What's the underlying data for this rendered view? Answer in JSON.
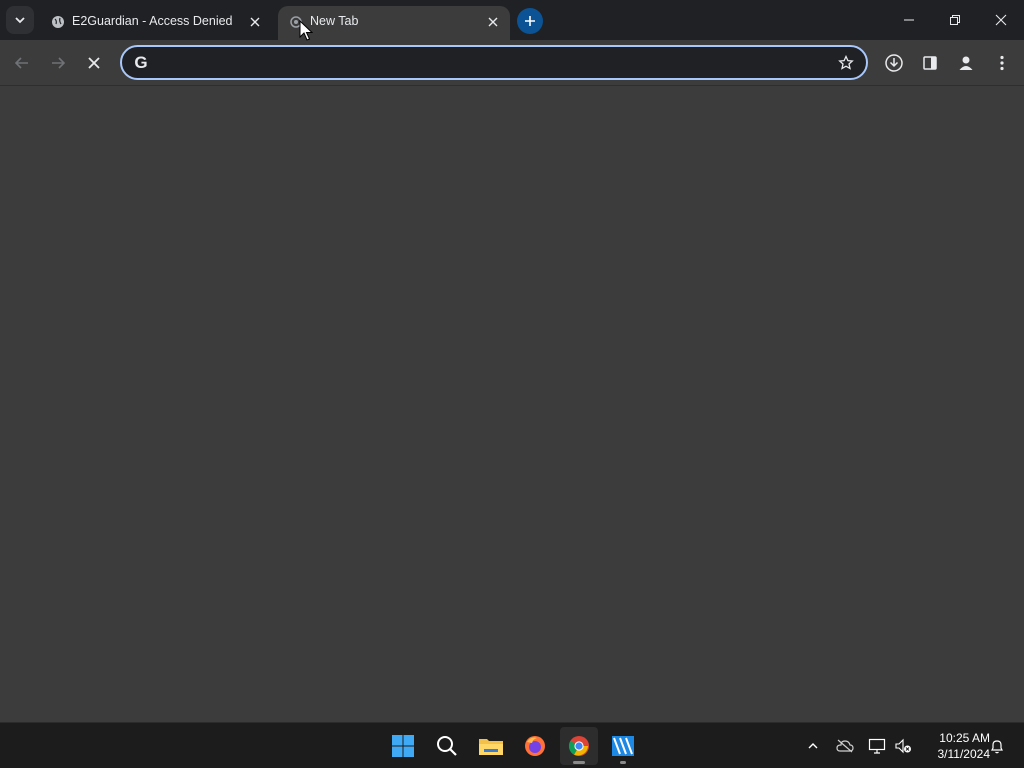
{
  "browser": {
    "tabs": [
      {
        "title": "E2Guardian - Access Denied",
        "favicon": "globe-icon",
        "active": false
      },
      {
        "title": "New Tab",
        "favicon": "loading-icon",
        "active": true
      }
    ],
    "omnibox": {
      "value": "",
      "placeholder": ""
    }
  },
  "taskbar": {
    "apps": [
      "windows-start",
      "search",
      "file-explorer",
      "firefox",
      "chrome",
      "app"
    ],
    "time": "10:25 AM",
    "date": "3/11/2024"
  },
  "colors": {
    "accent": "#a8c7fa",
    "newtab": "#0b5394"
  }
}
